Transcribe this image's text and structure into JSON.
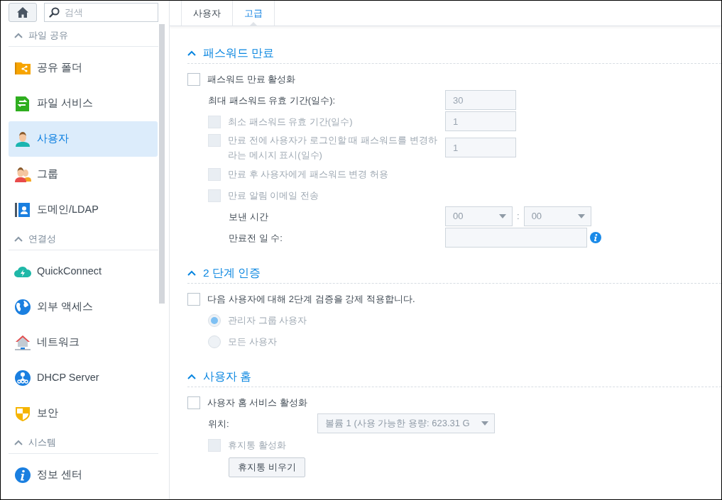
{
  "sidebar": {
    "search": {
      "placeholder": "검색"
    },
    "sections": [
      {
        "title": "파일 공유",
        "expanded": true,
        "items": [
          {
            "label": "공유 폴더",
            "kind": "shared-folder",
            "selected": false
          },
          {
            "label": "파일 서비스",
            "kind": "file-service",
            "selected": false
          },
          {
            "label": "사용자",
            "kind": "user",
            "selected": true
          },
          {
            "label": "그룹",
            "kind": "group",
            "selected": false
          },
          {
            "label": "도메인/LDAP",
            "kind": "directory",
            "selected": false
          }
        ]
      },
      {
        "title": "연결성",
        "expanded": true,
        "items": [
          {
            "label": "QuickConnect",
            "kind": "cloud",
            "selected": false
          },
          {
            "label": "외부 액세스",
            "kind": "globe",
            "selected": false
          },
          {
            "label": "네트워크",
            "kind": "house",
            "selected": false
          },
          {
            "label": "DHCP Server",
            "kind": "nodes",
            "selected": false
          },
          {
            "label": "보안",
            "kind": "shield",
            "selected": false
          }
        ]
      },
      {
        "title": "시스템",
        "expanded": true,
        "items": [
          {
            "label": "정보 센터",
            "kind": "info",
            "selected": false
          }
        ]
      }
    ]
  },
  "tabs": [
    {
      "label": "사용자",
      "selected": false
    },
    {
      "label": "고급",
      "selected": true
    }
  ],
  "sections": [
    {
      "title": "패스워드 만료",
      "expanded": true,
      "rows": [
        {
          "kind": "checkbox",
          "label": "패스워드 만료 활성화",
          "checked": false,
          "disabled": false,
          "children": [
            {
              "kind": "field",
              "label": "최대 패스워드 유효 기간(일수):",
              "value": "30"
            },
            {
              "kind": "checkbox-field",
              "label": "최소 패스워드 유효 기간(일수)",
              "checked": false,
              "disabled": true,
              "value": "1"
            },
            {
              "kind": "checkbox-field",
              "label": "만료 전에 사용자가 로그인할 때 패스워드를 변경하라는 메시지 표시(일수)",
              "checked": false,
              "disabled": true,
              "value": "1"
            },
            {
              "kind": "checkbox",
              "label": "만료 후 사용자에게 패스워드 변경 허용",
              "checked": false,
              "disabled": true
            },
            {
              "kind": "checkbox",
              "label": "만료 알림 이메일 전송",
              "checked": false,
              "disabled": true,
              "children": [
                {
                  "kind": "time",
                  "label": "보낸 시간",
                  "hour": "00",
                  "separator": ":",
                  "minute": "00"
                },
                {
                  "kind": "field-info",
                  "label": "만료전 일 수:"
                }
              ]
            }
          ]
        }
      ]
    },
    {
      "title": "2 단계 인증",
      "expanded": true,
      "rows": [
        {
          "kind": "checkbox",
          "label": "다음 사용자에 대해 2단계 검증을 강제 적용합니다.",
          "checked": false,
          "disabled": false,
          "children": [
            {
              "kind": "radio",
              "label": "관리자 그룹 사용자",
              "selected": true,
              "disabled": true
            },
            {
              "kind": "radio",
              "label": "모든 사용자",
              "selected": false,
              "disabled": true
            }
          ]
        }
      ]
    },
    {
      "title": "사용자 홈",
      "expanded": true,
      "rows": [
        {
          "kind": "checkbox",
          "label": "사용자 홈 서비스 활성화",
          "checked": false,
          "disabled": false,
          "children": [
            {
              "kind": "select",
              "label": "위치:",
              "value": "볼륨 1 (사용 가능한 용량: 623.31 G"
            },
            {
              "kind": "checkbox",
              "label": "휴지통 활성화",
              "checked": false,
              "disabled": true,
              "children": [
                {
                  "kind": "button",
                  "label": "휴지통 비우기"
                }
              ]
            }
          ]
        }
      ]
    }
  ]
}
